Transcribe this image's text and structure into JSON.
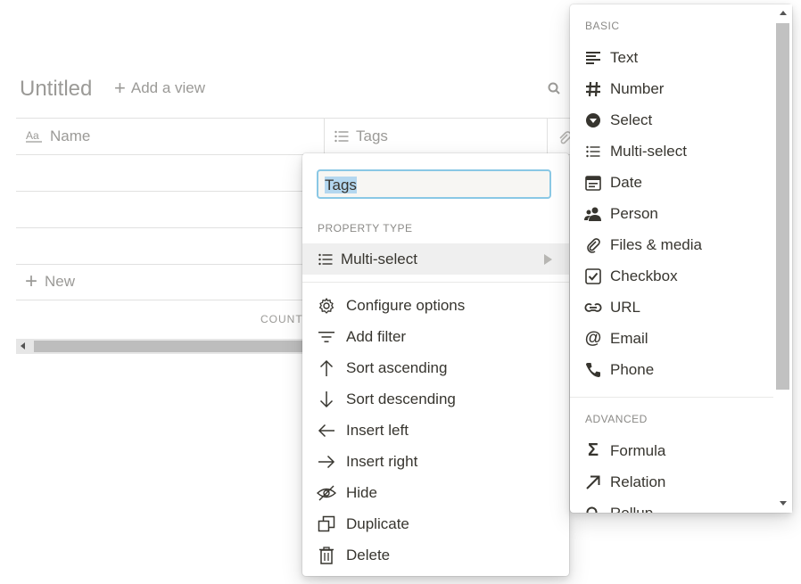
{
  "database": {
    "title": "Untitled",
    "add_view_label": "Add a view",
    "columns": [
      {
        "label": "Name",
        "icon": "text-aa-icon"
      },
      {
        "label": "Tags",
        "icon": "list-icon"
      }
    ],
    "new_row_label": "New",
    "count_label": "COUNT"
  },
  "property_menu": {
    "name_value": "Tags",
    "section_label": "PROPERTY TYPE",
    "current_type": "Multi-select",
    "actions": [
      {
        "label": "Configure options",
        "icon": "gear-icon"
      },
      {
        "label": "Add filter",
        "icon": "filter-icon"
      },
      {
        "label": "Sort ascending",
        "icon": "arrow-up-icon"
      },
      {
        "label": "Sort descending",
        "icon": "arrow-down-icon"
      },
      {
        "label": "Insert left",
        "icon": "arrow-left-icon"
      },
      {
        "label": "Insert right",
        "icon": "arrow-right-icon"
      },
      {
        "label": "Hide",
        "icon": "eye-slash-icon"
      },
      {
        "label": "Duplicate",
        "icon": "duplicate-icon"
      },
      {
        "label": "Delete",
        "icon": "trash-icon"
      }
    ]
  },
  "type_list": {
    "basic_label": "BASIC",
    "basic": [
      {
        "label": "Text",
        "icon": "text-icon"
      },
      {
        "label": "Number",
        "icon": "hash-icon"
      },
      {
        "label": "Select",
        "icon": "select-icon"
      },
      {
        "label": "Multi-select",
        "icon": "list-icon"
      },
      {
        "label": "Date",
        "icon": "calendar-icon"
      },
      {
        "label": "Person",
        "icon": "person-icon"
      },
      {
        "label": "Files & media",
        "icon": "paperclip-icon"
      },
      {
        "label": "Checkbox",
        "icon": "checkbox-icon"
      },
      {
        "label": "URL",
        "icon": "link-icon"
      },
      {
        "label": "Email",
        "icon": "at-icon"
      },
      {
        "label": "Phone",
        "icon": "phone-icon"
      }
    ],
    "advanced_label": "ADVANCED",
    "advanced": [
      {
        "label": "Formula",
        "icon": "sigma-icon"
      },
      {
        "label": "Relation",
        "icon": "arrow-diagonal-icon"
      },
      {
        "label": "Rollup",
        "icon": "search-icon"
      }
    ]
  }
}
